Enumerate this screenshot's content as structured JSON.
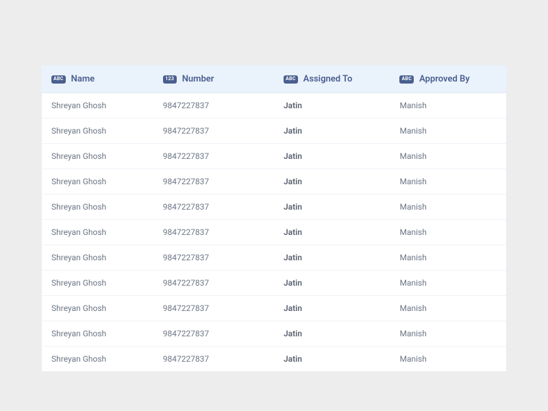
{
  "table": {
    "columns": [
      {
        "type_badge": "ABC",
        "label": "Name"
      },
      {
        "type_badge": "123",
        "label": "Number"
      },
      {
        "type_badge": "ABC",
        "label": "Assigned To"
      },
      {
        "type_badge": "ABC",
        "label": "Approved By"
      }
    ],
    "rows": [
      {
        "name": "Shreyan Ghosh",
        "number": "9847227837",
        "assigned_to": "Jatin",
        "approved_by": "Manish"
      },
      {
        "name": "Shreyan Ghosh",
        "number": "9847227837",
        "assigned_to": "Jatin",
        "approved_by": "Manish"
      },
      {
        "name": "Shreyan Ghosh",
        "number": "9847227837",
        "assigned_to": "Jatin",
        "approved_by": "Manish"
      },
      {
        "name": "Shreyan Ghosh",
        "number": "9847227837",
        "assigned_to": "Jatin",
        "approved_by": "Manish"
      },
      {
        "name": "Shreyan Ghosh",
        "number": "9847227837",
        "assigned_to": "Jatin",
        "approved_by": "Manish"
      },
      {
        "name": "Shreyan Ghosh",
        "number": "9847227837",
        "assigned_to": "Jatin",
        "approved_by": "Manish"
      },
      {
        "name": "Shreyan Ghosh",
        "number": "9847227837",
        "assigned_to": "Jatin",
        "approved_by": "Manish"
      },
      {
        "name": "Shreyan Ghosh",
        "number": "9847227837",
        "assigned_to": "Jatin",
        "approved_by": "Manish"
      },
      {
        "name": "Shreyan Ghosh",
        "number": "9847227837",
        "assigned_to": "Jatin",
        "approved_by": "Manish"
      },
      {
        "name": "Shreyan Ghosh",
        "number": "9847227837",
        "assigned_to": "Jatin",
        "approved_by": "Manish"
      },
      {
        "name": "Shreyan Ghosh",
        "number": "9847227837",
        "assigned_to": "Jatin",
        "approved_by": "Manish"
      }
    ]
  }
}
